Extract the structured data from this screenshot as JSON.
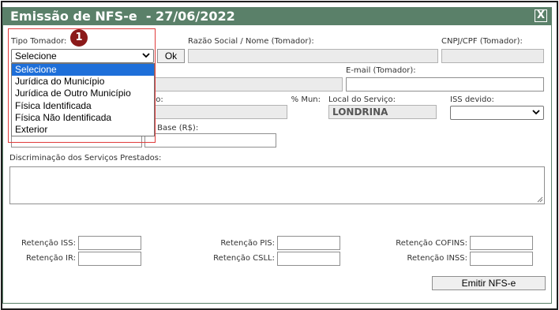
{
  "dialog": {
    "title": "Emissão de NFS-e  - 27/06/2022",
    "close_label": "X",
    "colors": {
      "titlebar": "#5a8069",
      "highlight": "#1e6fd9",
      "annotation": "#8b1a1a"
    }
  },
  "tomador": {
    "tipo_label": "Tipo Tomador:",
    "tipo_value": "Selecione",
    "ok_label": "Ok",
    "razao_label": "Razão Social / Nome (Tomador):",
    "cnpj_label": "CNPJ/CPF (Tomador):",
    "email_label": "E-mail (Tomador):"
  },
  "dropdown": {
    "options": [
      "Selecione",
      "Jurídica do Município",
      "Jurídica de Outro Município",
      "Física Identificada",
      "Física Não Identificada",
      "Exterior"
    ],
    "selected_index": 0
  },
  "servico": {
    "servico_label": "viço:",
    "mun_label": "% Mun:",
    "local_label": "Local do Serviço:",
    "local_value": "LONDRINA",
    "iss_label": "ISS devido:",
    "valor_base_label": "lor Base (R$):"
  },
  "discriminacao": {
    "label": "Discriminação dos Serviços Prestados:"
  },
  "retencoes": {
    "iss": "Retenção ISS:",
    "ir": "Retenção IR:",
    "pis": "Retenção PIS:",
    "csll": "Retenção CSLL:",
    "cofins": "Retenção COFINS:",
    "inss": "Retenção INSS:"
  },
  "actions": {
    "emitir": "Emitir NFS-e"
  },
  "annotation": {
    "marker": "1"
  },
  "icons": {
    "close": "close-icon",
    "chevron": "chevron-down-icon",
    "resize": "resize-grip-icon"
  }
}
